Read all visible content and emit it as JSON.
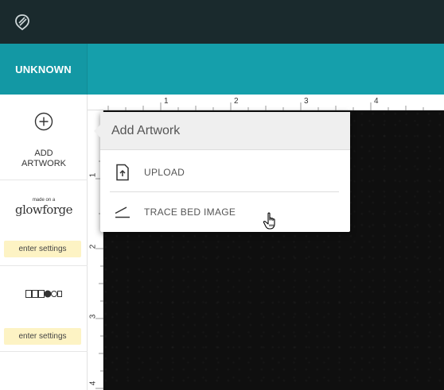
{
  "header": {
    "logo_icon": "glowforge-logo-icon"
  },
  "design": {
    "name": "UNKNOWN"
  },
  "sidebar": {
    "add_artwork_label_line1": "ADD",
    "add_artwork_label_line2": "ARTWORK",
    "items": [
      {
        "logo_small": "made on a",
        "logo_big": "glowforge",
        "settings_label": "enter settings"
      },
      {
        "icon": "material-shapes-icon",
        "settings_label": "enter settings"
      }
    ]
  },
  "rulers": {
    "top": [
      "1",
      "2",
      "3",
      "4"
    ],
    "left": [
      "1",
      "2",
      "3",
      "4"
    ]
  },
  "add_artwork_menu": {
    "title": "Add Artwork",
    "options": [
      {
        "label": "UPLOAD",
        "icon": "upload-icon"
      },
      {
        "label": "TRACE BED IMAGE",
        "icon": "trace-icon"
      }
    ]
  },
  "colors": {
    "topbar": "#1a2a2d",
    "titlebar": "#159fab",
    "settings_bg": "#fdf3c4"
  }
}
